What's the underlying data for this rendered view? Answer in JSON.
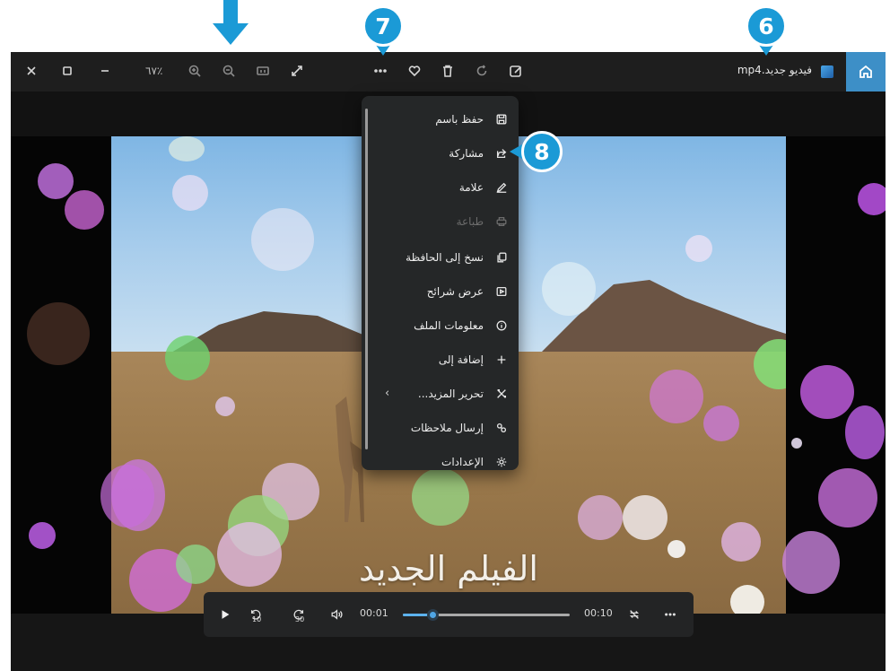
{
  "titlebar": {
    "file_name": "فيديو جديد.mp4",
    "zoom_percent": "٦٧٪"
  },
  "menu": {
    "items": [
      {
        "label": "حفظ باسم",
        "icon": "save-icon",
        "enabled": true
      },
      {
        "label": "مشاركة",
        "icon": "share-icon",
        "enabled": true
      },
      {
        "label": "علامة",
        "icon": "markup-pen-icon",
        "enabled": true
      },
      {
        "label": "طباعة",
        "icon": "print-icon",
        "enabled": false
      },
      {
        "label": "نسخ إلى الحافظة",
        "icon": "copy-icon",
        "enabled": true
      },
      {
        "label": "عرض شرائح",
        "icon": "slideshow-icon",
        "enabled": true
      },
      {
        "label": "معلومات الملف",
        "icon": "info-icon",
        "enabled": true
      },
      {
        "label": "إضافة إلى",
        "icon": "plus-icon",
        "enabled": true
      },
      {
        "label": "تحرير المزيد...",
        "icon": "edit-more-icon",
        "enabled": true,
        "submenu": true
      },
      {
        "label": "إرسال ملاحظات",
        "icon": "feedback-icon",
        "enabled": true
      },
      {
        "label": "الإعدادات",
        "icon": "settings-gear-icon",
        "enabled": true
      }
    ]
  },
  "video": {
    "title_overlay": "الفيلم الجديد"
  },
  "player": {
    "current_time": "00:01",
    "total_time": "00:10",
    "progress_fraction": 0.18,
    "rewind_seconds": "10",
    "forward_seconds": "30"
  },
  "callouts": {
    "c6": "6",
    "c7": "7",
    "c8": "8"
  },
  "colors": {
    "accent": "#3d8fc7",
    "callout": "#1b9ad6",
    "seek": "#5cb2ee"
  }
}
